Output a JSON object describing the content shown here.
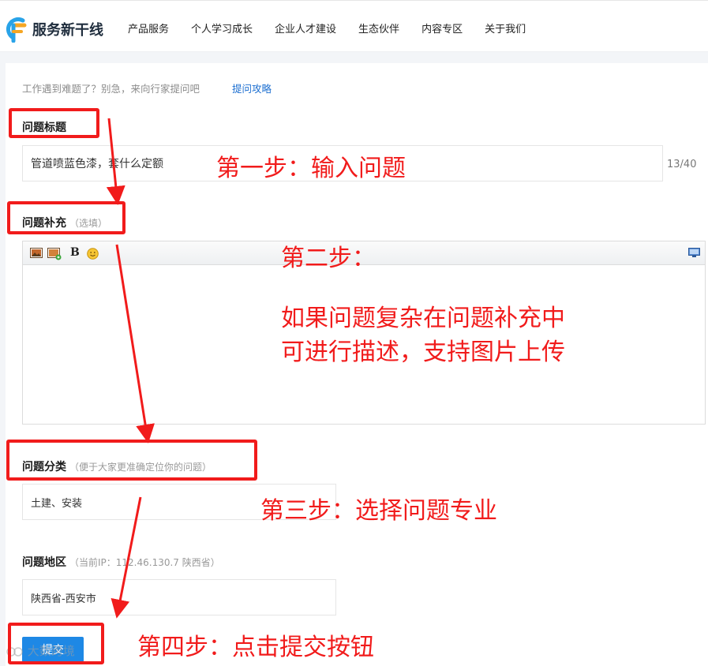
{
  "header": {
    "logo_text": "服务新干线",
    "nav": [
      "产品服务",
      "个人学习成长",
      "企业人才建设",
      "生态伙伴",
      "内容专区",
      "关于我们"
    ]
  },
  "form": {
    "hint": "工作遇到难题了？别急，来向行家提问吧",
    "hint_link": "提问攻略",
    "title_label": "问题标题",
    "title_value": "管道喷蓝色漆，套什么定额",
    "title_counter": "13/40",
    "supplement_label": "问题补充",
    "supplement_sub": "（选填）",
    "category_label": "问题分类",
    "category_sub": "（便于大家更准确定位你的问题）",
    "category_value": "土建、安装",
    "region_label": "问题地区",
    "region_sub": "（当前IP：112.46.130.7 陕西省）",
    "region_value": "陕西省-西安市",
    "submit_label": "提交"
  },
  "toolbar": {
    "icons": [
      "image-icon",
      "image-upload-icon",
      "bold-icon",
      "emoji-icon",
      "fullscreen-icon"
    ],
    "bold_glyph": "B"
  },
  "annotations": {
    "step1": "第一步：输入问题",
    "step2_title": "第二步：",
    "step2_line1": "如果问题复杂在问题补充中",
    "step2_line2": "可进行描述，支持图片上传",
    "step3": "第三步：选择问题专业",
    "step4": "第四步：点击提交按钮",
    "color": "#f11b1b"
  },
  "watermark": "大数跨境",
  "colors": {
    "accent": "#1e88e5",
    "link": "#1d6fd0"
  }
}
